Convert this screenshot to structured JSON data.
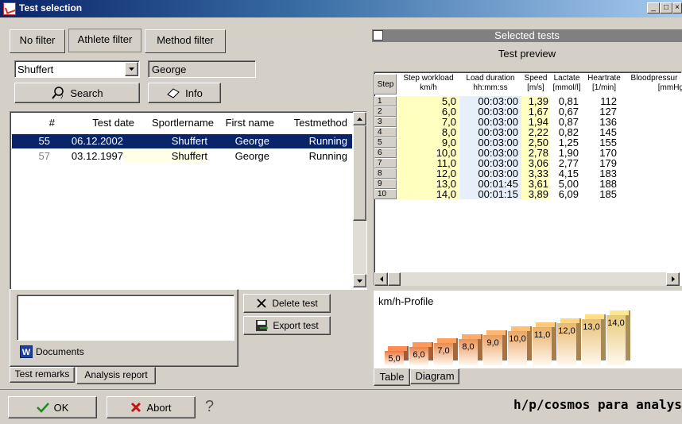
{
  "window": {
    "title": "Test selection"
  },
  "title_buttons": {
    "minimize": "_",
    "maximize": "□",
    "close": "×"
  },
  "filter_tabs": [
    {
      "label": "No filter"
    },
    {
      "label": "Athlete filter"
    },
    {
      "label": "Method filter"
    }
  ],
  "athlete": {
    "selected": "Shuffert",
    "first_name": "George"
  },
  "buttons": {
    "search": "Search",
    "info": "Info",
    "delete_test": "Delete test",
    "export_test": "Export test",
    "ok": "OK",
    "abort": "Abort",
    "help": "?"
  },
  "tests_table": {
    "columns": [
      "#",
      "Test date",
      "Sportlername",
      "First name",
      "Testmethod"
    ],
    "rows": [
      {
        "num": "55",
        "date": "06.12.2002",
        "sportlername": "Shuffert",
        "first_name": "George",
        "method": "Running"
      },
      {
        "num": "57",
        "date": "03.12.1997",
        "sportlername": "Shuffert",
        "first_name": "George",
        "method": "Running"
      }
    ]
  },
  "documents": {
    "label": "Documents"
  },
  "bottom_tabs": [
    {
      "label": "Test remarks"
    },
    {
      "label": "Analysis report"
    }
  ],
  "selected_tests": {
    "label": "Selected tests"
  },
  "test_preview": {
    "label": "Test preview"
  },
  "preview_grid": {
    "step_header": "Step",
    "headers": [
      {
        "name": "Step workload",
        "unit": "km/h"
      },
      {
        "name": "Load duration",
        "unit": "hh:mm:ss"
      },
      {
        "name": "Speed",
        "unit": "[m/s]"
      },
      {
        "name": "Lactate",
        "unit": "[mmol/l]"
      },
      {
        "name": "Heartrate",
        "unit": "[1/min]"
      },
      {
        "name": "Bloodpressur",
        "unit": "[mmHg"
      }
    ],
    "rows": [
      {
        "step": "1",
        "workload": "5,0",
        "duration": "00:03:00",
        "speed": "1,39",
        "lactate": "0,81",
        "heartrate": "112"
      },
      {
        "step": "2",
        "workload": "6,0",
        "duration": "00:03:00",
        "speed": "1,67",
        "lactate": "0,67",
        "heartrate": "127"
      },
      {
        "step": "3",
        "workload": "7,0",
        "duration": "00:03:00",
        "speed": "1,94",
        "lactate": "0,87",
        "heartrate": "136"
      },
      {
        "step": "4",
        "workload": "8,0",
        "duration": "00:03:00",
        "speed": "2,22",
        "lactate": "0,82",
        "heartrate": "145"
      },
      {
        "step": "5",
        "workload": "9,0",
        "duration": "00:03:00",
        "speed": "2,50",
        "lactate": "1,25",
        "heartrate": "155"
      },
      {
        "step": "6",
        "workload": "10,0",
        "duration": "00:03:00",
        "speed": "2,78",
        "lactate": "1,90",
        "heartrate": "170"
      },
      {
        "step": "7",
        "workload": "11,0",
        "duration": "00:03:00",
        "speed": "3,06",
        "lactate": "2,77",
        "heartrate": "179"
      },
      {
        "step": "8",
        "workload": "12,0",
        "duration": "00:03:00",
        "speed": "3,33",
        "lactate": "4,15",
        "heartrate": "183"
      },
      {
        "step": "9",
        "workload": "13,0",
        "duration": "00:01:45",
        "speed": "3,61",
        "lactate": "5,00",
        "heartrate": "188"
      },
      {
        "step": "10",
        "workload": "14,0",
        "duration": "00:01:15",
        "speed": "3,89",
        "lactate": "6,09",
        "heartrate": "185"
      }
    ]
  },
  "profile_chart": {
    "title": "km/h-Profile",
    "values": [
      5.0,
      6.0,
      7.0,
      8.0,
      9.0,
      10.0,
      11.0,
      12.0,
      13.0,
      14.0
    ],
    "labels": [
      "5,0",
      "6,0",
      "7,0",
      "8,0",
      "9,0",
      "10,0",
      "11,0",
      "12,0",
      "13,0",
      "14,0"
    ]
  },
  "view_tabs": [
    {
      "label": "Table"
    },
    {
      "label": "Diagram"
    }
  ],
  "brand": "h/p/cosmos para analysis",
  "brand_mark": "©",
  "colors": {
    "title_start": "#0a246a",
    "selection": "#0a246a",
    "workload_cells": "#ffffc0",
    "duration_cells": "#e6effa",
    "header_dark": "#808080",
    "bar_low": "#e87b47",
    "bar_high": "#e8c97a"
  }
}
